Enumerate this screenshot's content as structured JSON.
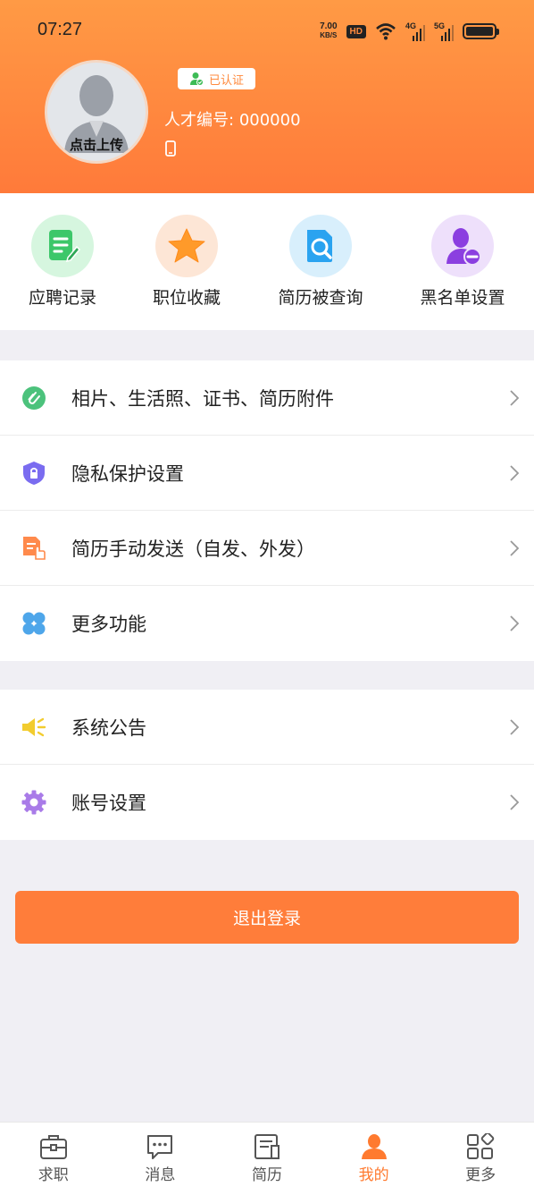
{
  "status_bar": {
    "time": "07:27",
    "net_speed_value": "7.00",
    "net_speed_unit": "KB/S",
    "hd": "HD",
    "signal_1": "4G",
    "signal_2": "5G"
  },
  "profile": {
    "avatar_upload_label": "点击上传",
    "verified_label": "已认证",
    "talent_id_label": "人才编号:",
    "talent_id_value": "000000"
  },
  "quick_actions": [
    {
      "label": "应聘记录",
      "icon": "document-edit-icon",
      "color": "#3dc76a"
    },
    {
      "label": "职位收藏",
      "icon": "star-icon",
      "color": "#ff9a2a"
    },
    {
      "label": "简历被查询",
      "icon": "search-document-icon",
      "color": "#2aa3f0"
    },
    {
      "label": "黑名单设置",
      "icon": "user-block-icon",
      "color": "#8b3fe0"
    }
  ],
  "menu_group_1": [
    {
      "label": "相片、生活照、证书、简历附件",
      "icon": "paperclip-icon",
      "color": "#4cc27c"
    },
    {
      "label": "隐私保护设置",
      "icon": "shield-lock-icon",
      "color": "#7a6cf0"
    },
    {
      "label": "简历手动发送（自发、外发）",
      "icon": "resume-send-icon",
      "color": "#ff8a4c"
    },
    {
      "label": "更多功能",
      "icon": "grid-icon",
      "color": "#4ea6ea"
    }
  ],
  "menu_group_2": [
    {
      "label": "系统公告",
      "icon": "megaphone-icon",
      "color": "#f2cc2e"
    },
    {
      "label": "账号设置",
      "icon": "gear-icon",
      "color": "#a97be8"
    }
  ],
  "logout_label": "退出登录",
  "tabs": [
    {
      "label": "求职",
      "icon": "briefcase-icon",
      "active": false
    },
    {
      "label": "消息",
      "icon": "chat-icon",
      "active": false
    },
    {
      "label": "简历",
      "icon": "resume-icon",
      "active": false
    },
    {
      "label": "我的",
      "icon": "person-icon",
      "active": true
    },
    {
      "label": "更多",
      "icon": "apps-icon",
      "active": false
    }
  ],
  "colors": {
    "accent": "#ff7d3a",
    "header_top": "#ff9a45",
    "background": "#f0eff4"
  }
}
